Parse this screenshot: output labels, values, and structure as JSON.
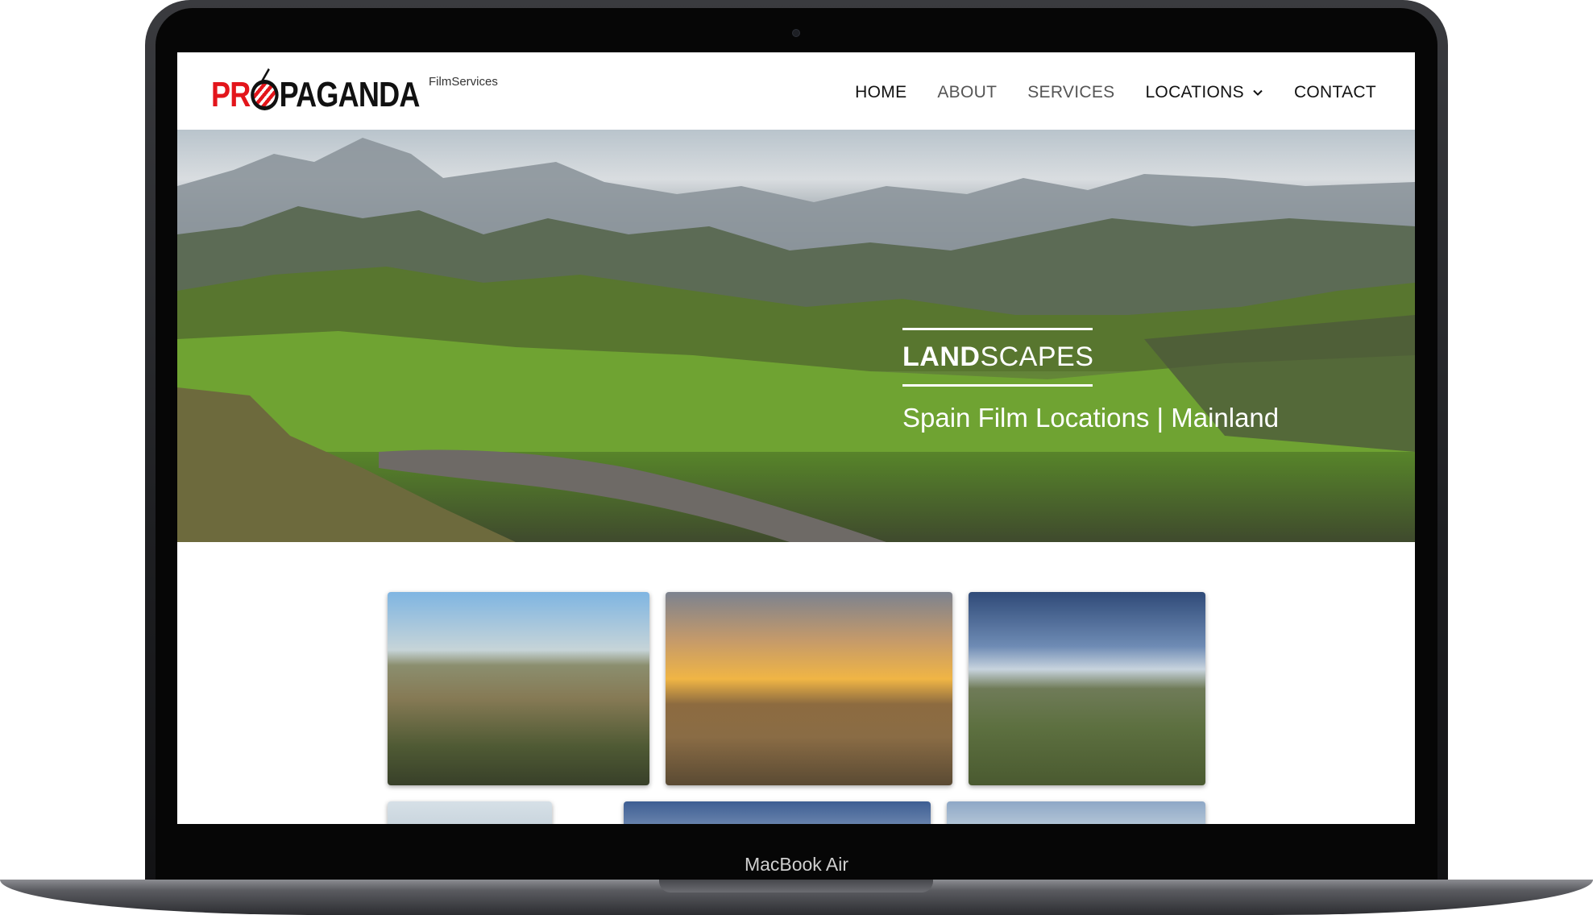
{
  "device": {
    "label": "MacBook Air"
  },
  "brand": {
    "logo_part1": "PR",
    "logo_part2": "PAGANDA",
    "tagline": "FilmServices",
    "accent_color": "#e3151b"
  },
  "nav": {
    "home": "HOME",
    "about": "ABOUT",
    "services": "SERVICES",
    "locations": "LOCATIONS",
    "contact": "CONTACT"
  },
  "hero": {
    "title_bold": "LAND",
    "title_rest": "SCAPES",
    "subtitle": "Spain Film Locations | Mainland"
  },
  "gallery": {
    "tiles": [
      {
        "icon": "landscape-photo"
      },
      {
        "icon": "observatory-sunset-photo"
      },
      {
        "icon": "boardwalk-photo"
      },
      {
        "icon": "photo"
      },
      {
        "icon": "photo"
      },
      {
        "icon": "photo"
      }
    ]
  }
}
